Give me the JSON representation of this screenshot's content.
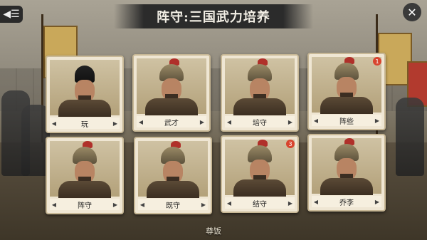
{
  "header": {
    "title": "阵守:三国武力培养",
    "back_icon": "back-list-icon",
    "close_icon": "close-icon"
  },
  "cards": [
    {
      "name": "玩",
      "badge": ""
    },
    {
      "name": "武才",
      "badge": ""
    },
    {
      "name": "培守",
      "badge": ""
    },
    {
      "name": "阵些",
      "badge": "1"
    },
    {
      "name": "阵守",
      "badge": ""
    },
    {
      "name": "既守",
      "badge": ""
    },
    {
      "name": "结守",
      "badge": "3"
    },
    {
      "name": "乔李",
      "badge": ""
    }
  ],
  "footer": {
    "label": "尊饭"
  },
  "colors": {
    "card_bg": "#efe6d3",
    "badge": "#d8442e",
    "title_bg": "#2b2b2b"
  }
}
